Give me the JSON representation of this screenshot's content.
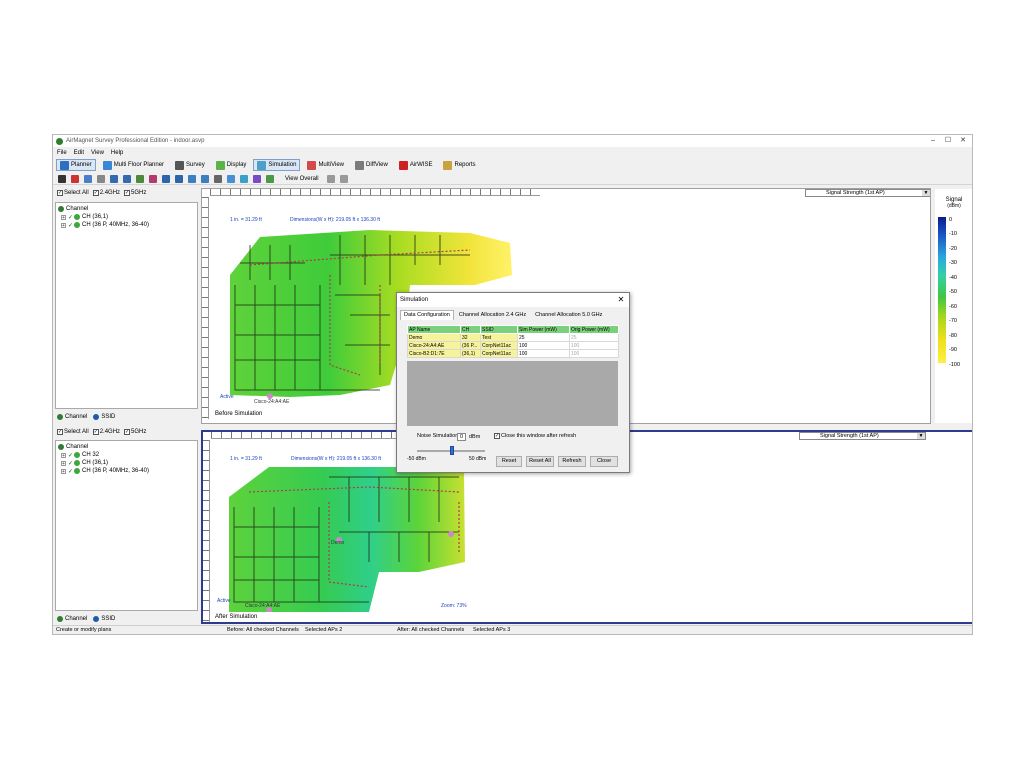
{
  "app": {
    "title": "AirMagnet Survey Professional Edition - indoor.asvp"
  },
  "window_controls": {
    "minimize": "–",
    "maximize": "☐",
    "close": "✕"
  },
  "menu": [
    "File",
    "Edit",
    "View",
    "Help"
  ],
  "main_tabs": [
    "Planner",
    "Multi Floor Planner",
    "Survey",
    "Display",
    "Simulation",
    "MultiView",
    "DiffView",
    "AirWISE",
    "Reports"
  ],
  "toolbar": {
    "view_selector": "View Overall"
  },
  "top_panel": {
    "filters": {
      "select_all": "Select All",
      "band_24": "2.4GHz",
      "band_5": "5GHz"
    },
    "tree_root": "Channel",
    "tree_items": [
      "CH (36,1)",
      "CH (36 P, 40MHz, 36-40)"
    ],
    "tabs": {
      "channel": "Channel",
      "ssid": "SSID"
    },
    "signal_dropdown": "Signal Strength (1st AP)",
    "map_caption": "Before Simulation",
    "scale_label": "1 in. = 31.29 ft",
    "dimensions_label": "Dimensions(W x H): 219.05 ft x 136.30 ft",
    "ap_label": "Cisco-24:A4:AE",
    "active_label": "Active"
  },
  "bottom_panel": {
    "filters": {
      "select_all": "Select All",
      "band_24": "2.4GHz",
      "band_5": "5GHz"
    },
    "tree_root": "Channel",
    "tree_items": [
      "CH 32",
      "CH (36,1)",
      "CH (36 P, 40MHz, 36-40)"
    ],
    "tabs": {
      "channel": "Channel",
      "ssid": "SSID"
    },
    "signal_dropdown": "Signal Strength (1st AP)",
    "map_caption": "After Simulation",
    "scale_label": "1 in. = 31.29 ft",
    "dimensions_label": "Dimensions(W x H): 219.05 ft x 136.30 ft",
    "ap_label": "Cisco-24:A4:AE",
    "demo_label": "Demo",
    "active_label": "Active",
    "zoom_label": "Zoom: 73%"
  },
  "legend": {
    "title": "Signal",
    "unit": "(dBm)",
    "ticks": [
      "0",
      "-10",
      "-20",
      "-30",
      "-40",
      "-50",
      "-60",
      "-70",
      "-80",
      "-90",
      "-100"
    ]
  },
  "status": {
    "left": "Create or modify plans",
    "before_channels": "Before: All checked Channels",
    "before_aps": "Selected APs 2",
    "after_channels": "After: All checked Channels",
    "after_aps": "Selected APs 3"
  },
  "dialog": {
    "title": "Simulation",
    "close": "✕",
    "tabs": [
      "Data Configuration",
      "Channel Allocation 2.4 GHz",
      "Channel Allocation 5.0 GHz"
    ],
    "columns": [
      "AP Name",
      "CH",
      "SSID",
      "Sim Power (mW)",
      "Orig Power (mW)"
    ],
    "rows": [
      [
        "Demo",
        "32",
        "Test",
        "25",
        "25"
      ],
      [
        "Cisco-24:A4:AE",
        "(36 P...",
        "CorpNet11ac",
        "100",
        "100"
      ],
      [
        "Cisco-B2:D1:7E",
        "(36,1)",
        "CorpNet11ac",
        "100",
        "100"
      ]
    ],
    "noise_label": "Noise Simulation",
    "noise_value": "0",
    "noise_unit": "dBm",
    "slider_min": "-50 dBm",
    "slider_max": "50 dBm",
    "close_after_refresh": "Close this window after refresh",
    "buttons": {
      "reset": "Reset",
      "reset_all": "Reset All",
      "refresh": "Refresh",
      "close": "Close"
    }
  }
}
